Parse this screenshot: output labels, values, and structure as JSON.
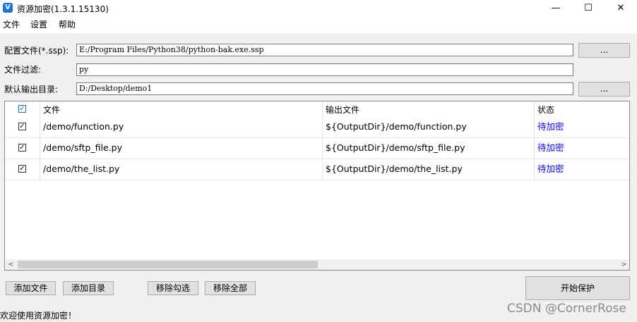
{
  "window": {
    "title": "资源加密(1.3.1.15130)",
    "app_icon_letter": "V",
    "minimize_glyph": "—",
    "maximize_glyph": "☐",
    "close_glyph": "✕"
  },
  "menu": [
    "文件",
    "设置",
    "帮助"
  ],
  "form": {
    "config_label": "配置文件(*.ssp):",
    "config_value": "E:/Program Files/Python38/python-bak.exe.ssp",
    "filter_label": "文件过滤:",
    "filter_value": "py",
    "output_label": "默认输出目录:",
    "output_value": "D:/Desktop/demo1",
    "browse_label": "..."
  },
  "table": {
    "columns": [
      "文件",
      "输出文件",
      "状态"
    ],
    "header_checked": true,
    "rows": [
      {
        "checked": true,
        "file": "/demo/function.py",
        "output": "${OutputDir}/demo/function.py",
        "status": "待加密"
      },
      {
        "checked": true,
        "file": "/demo/sftp_file.py",
        "output": "${OutputDir}/demo/sftp_file.py",
        "status": "待加密"
      },
      {
        "checked": true,
        "file": "/demo/the_list.py",
        "output": "${OutputDir}/demo/the_list.py",
        "status": "待加密"
      }
    ],
    "scroll_left_glyph": "<",
    "scroll_right_glyph": ">"
  },
  "buttons": {
    "add_file": "添加文件",
    "add_dir": "添加目录",
    "remove_checked": "移除勾选",
    "remove_all": "移除全部",
    "start": "开始保护"
  },
  "status_text": "欢迎使用资源加密！",
  "watermark": "CSDN @CornerRose",
  "colors": {
    "status_link": "#0000ff",
    "app_icon": "#1f6fe0"
  }
}
